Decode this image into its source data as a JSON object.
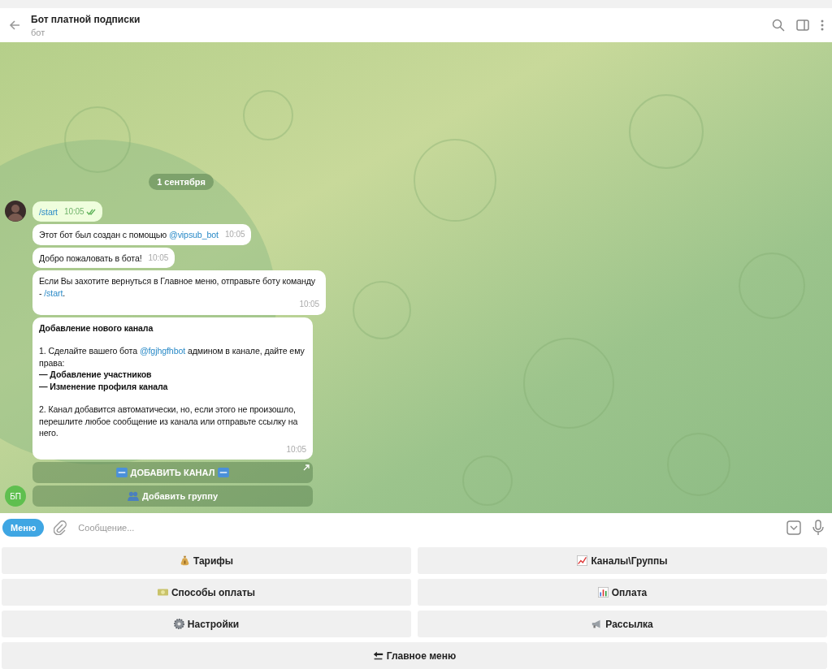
{
  "header": {
    "title": "Бот платной подписки",
    "subtitle": "бот"
  },
  "chat": {
    "date": "1 сентября",
    "messages": [
      {
        "kind": "sent",
        "read": true,
        "time": "10:05",
        "paragraphs": [
          [
            {
              "text": "/start",
              "kind": "link"
            }
          ]
        ]
      },
      {
        "kind": "received",
        "time": "10:05",
        "paragraphs": [
          [
            {
              "text": "Этот бот был создан с помощью ",
              "kind": "plain"
            },
            {
              "text": "@vipsub_bot",
              "kind": "link"
            }
          ]
        ]
      },
      {
        "kind": "received",
        "time": "10:05",
        "paragraphs": [
          [
            {
              "text": "Добро пожаловать в бота!",
              "kind": "plain"
            }
          ]
        ]
      },
      {
        "kind": "received",
        "time": "10:05",
        "paragraphs": [
          [
            {
              "text": "Если Вы захотите вернуться в Главное меню, отправьте боту команду - ",
              "kind": "plain"
            },
            {
              "text": "/start",
              "kind": "link"
            },
            {
              "text": ".",
              "kind": "plain"
            }
          ]
        ]
      },
      {
        "kind": "received",
        "time": "10:05",
        "paragraphs": [
          [
            {
              "text": "Добавление нового канала",
              "kind": "bold"
            }
          ],
          [
            {
              "text": "1. Сделайте вашего бота ",
              "kind": "plain"
            },
            {
              "text": "@fgjhgfhbot",
              "kind": "link"
            },
            {
              "text": " админом в канале, дайте ему права:\n",
              "kind": "plain"
            },
            {
              "text": "— Добавление участников\n— Изменение профиля канала",
              "kind": "bold"
            }
          ],
          [
            {
              "text": "2. Канал добавится автоматически, но, если этого не произошло, перешлите любое сообщение из канала или отправьте ссылку на него.",
              "kind": "plain"
            }
          ]
        ]
      }
    ],
    "inline_buttons": [
      {
        "label": "ДОБАВИТЬ КАНАЛ",
        "kind": "url"
      },
      {
        "label": "Добавить группу",
        "kind": "callback"
      }
    ],
    "bot_avatar": "БП"
  },
  "composer": {
    "menu_button": "Меню",
    "placeholder": "Сообщение..."
  },
  "keyboard": [
    "Тарифы",
    "Каналы\\Группы",
    "Способы оплаты",
    "Оплата",
    "Настройки",
    "Рассылка",
    "Главное меню"
  ]
}
